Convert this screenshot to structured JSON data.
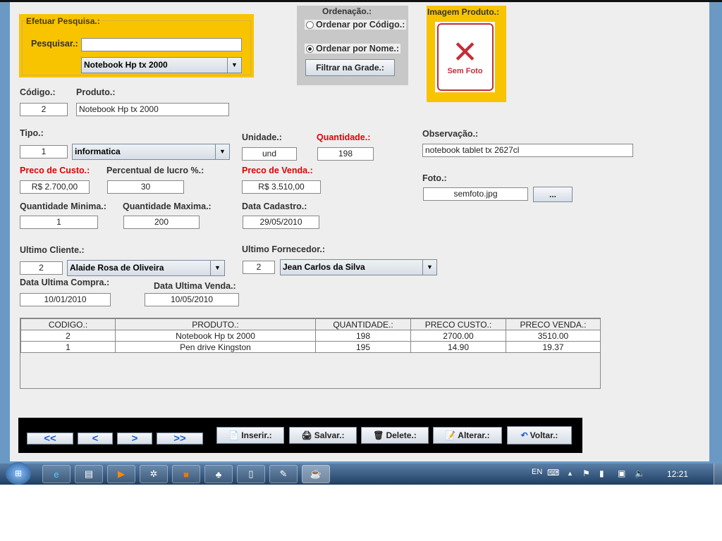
{
  "search": {
    "title": "Efetuar Pesquisa.:",
    "label": "Pesquisar.:",
    "value": "",
    "combo": "Notebook Hp tx 2000"
  },
  "ordering": {
    "title": "Ordenação.:",
    "by_code": "Ordenar por Código.:",
    "by_name": "Ordenar por Nome.:",
    "selected": "by_name",
    "filter_button": "Filtrar na Grade.:"
  },
  "image": {
    "title": "Imagem Produto.:",
    "placeholder": "Sem Foto"
  },
  "form": {
    "codigo_label": "Código.:",
    "codigo": "2",
    "produto_label": "Produto.:",
    "produto": "Notebook Hp tx 2000",
    "tipo_label": "Tipo.:",
    "tipo_id": "1",
    "tipo": "informatica",
    "unidade_label": "Unidade.:",
    "unidade": "und",
    "quantidade_label": "Quantidade.:",
    "quantidade": "198",
    "observacao_label": "Observação.:",
    "observacao": "notebook tablet tx 2627cl",
    "custo_label": "Preco de Custo.:",
    "custo": "R$ 2.700,00",
    "lucro_label": "Percentual de lucro %.:",
    "lucro": "30",
    "venda_label": "Preco de Venda.:",
    "venda": "R$ 3.510,00",
    "foto_label": "Foto.:",
    "foto": "semfoto.jpg",
    "foto_button": "...",
    "qmin_label": "Quantidade Minima.:",
    "qmin": "1",
    "qmax_label": "Quantidade Maxima.:",
    "qmax": "200",
    "cadastro_label": "Data Cadastro.:",
    "cadastro": "29/05/2010",
    "cliente_label": "Ultimo Cliente.:",
    "cliente_id": "2",
    "cliente": "Alaide Rosa de Oliveira",
    "fornecedor_label": "Ultimo Fornecedor.:",
    "fornecedor_id": "2",
    "fornecedor": "Jean Carlos da Silva",
    "compra_label": "Data Ultima Compra.:",
    "compra": "10/01/2010",
    "ultvenda_label": "Data Ultima Venda.:",
    "ultvenda": "10/05/2010"
  },
  "grid": {
    "headers": [
      "CODIGO.:",
      "PRODUTO.:",
      "QUANTIDADE.:",
      "PRECO CUSTO.:",
      "PRECO VENDA.:"
    ],
    "rows": [
      [
        "2",
        "Notebook Hp tx 2000",
        "198",
        "2700.00",
        "3510.00"
      ],
      [
        "1",
        "Pen drive Kingston",
        "195",
        "14.90",
        "19.37"
      ]
    ]
  },
  "toolbar": {
    "first": "<<",
    "prev": "<",
    "next": ">",
    "last": ">>",
    "inserir": "Inserir.:",
    "salvar": "Salvar.:",
    "delete": "Delete.:",
    "alterar": "Alterar.:",
    "voltar": "Voltar.:"
  },
  "taskbar": {
    "lang": "EN",
    "clock": "12:21"
  }
}
